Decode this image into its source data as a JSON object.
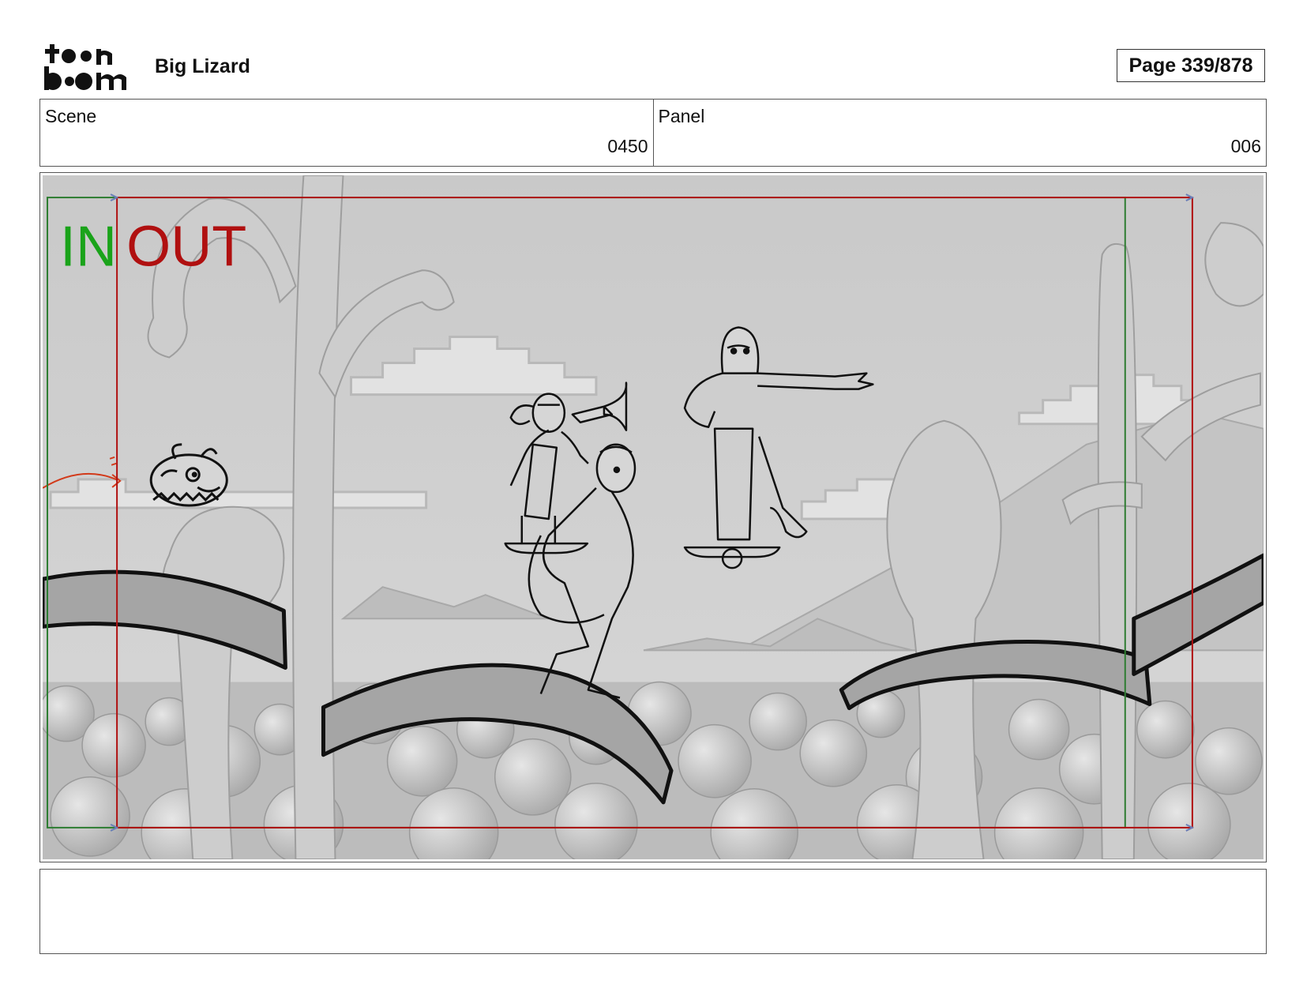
{
  "header": {
    "logo_text": "toon boom",
    "project_title": "Big Lizard",
    "page_label": "Page 339/878"
  },
  "scene": {
    "label": "Scene",
    "value": "0450"
  },
  "panel": {
    "label": "Panel",
    "value": "006"
  },
  "frame_overlay": {
    "in_label": "IN",
    "out_label": "OUT",
    "in_color": "#1aa31a",
    "out_color": "#b01010"
  },
  "notes": {
    "text": ""
  }
}
